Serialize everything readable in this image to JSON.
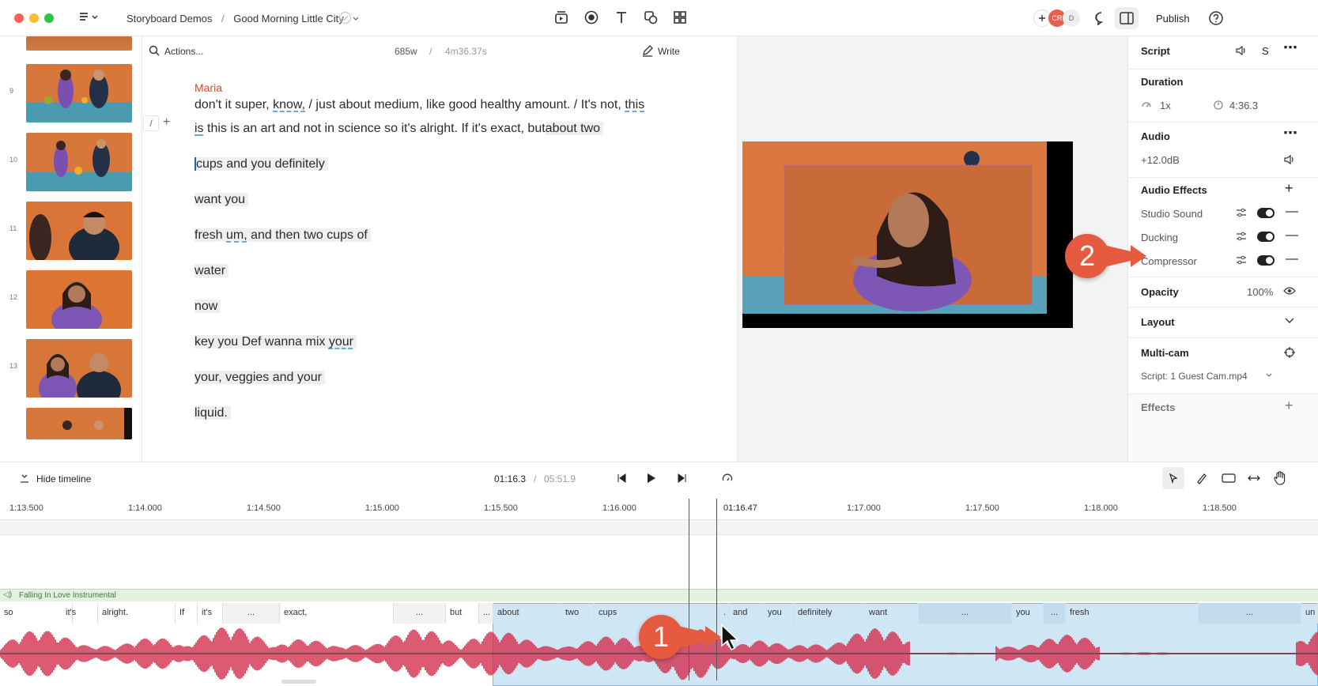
{
  "header": {
    "breadcrumb_project": "Storyboard Demos",
    "breadcrumb_separator": "/",
    "breadcrumb_doc": "Good Morning Little City",
    "avatar_initials_1": "CR",
    "avatar_initials_2": "D",
    "publish_label": "Publish"
  },
  "sidebar": {
    "scene_numbers": [
      "9",
      "10",
      "11",
      "12",
      "13"
    ]
  },
  "editor": {
    "search_label": "Actions...",
    "word_count": "685w",
    "divider": "/",
    "duration": "4m36.37s",
    "write_label": "Write",
    "speaker": "Maria",
    "line1_a": "don't it super, ",
    "line1_know": "know,",
    "line1_b": " / just about medium,   like good healthy amount. / It's not, ",
    "line1_this": "this",
    "line2_is": "is",
    "line2_b": " this is an art and not in science so it's alright. If it's exact, ",
    "line2_but": "but",
    "line2_chip": "about two",
    "line3": "cups and you definitely",
    "line4": "want you",
    "line5_a": "fresh ",
    "line5_um": "um,",
    "line5_b": " and then two cups of",
    "line6": "water",
    "line7": "now",
    "line8_a": "key you Def wanna mix ",
    "line8_your": "your",
    "line9": "your, veggies and your",
    "line10": "liquid."
  },
  "inspector": {
    "script_label": "Script",
    "script_s": "S",
    "duration_title": "Duration",
    "speed": "1x",
    "duration_value": "4:36.3",
    "audio_title": "Audio",
    "gain": "+12.0dB",
    "audio_effects_title": "Audio Effects",
    "effects": [
      {
        "name": "Studio Sound"
      },
      {
        "name": "Ducking"
      },
      {
        "name": "Compressor"
      }
    ],
    "opacity_title": "Opacity",
    "opacity_value": "100%",
    "layout_title": "Layout",
    "multicam_title": "Multi-cam",
    "multicam_value": "Script: 1 Guest Cam.mp4",
    "effects_title": "Effects"
  },
  "timeline": {
    "hide_label": "Hide timeline",
    "current_time": "01:16.3",
    "divider": "/",
    "total_time": "05:51.9",
    "playhead_label": "01:16.47",
    "ruler": [
      "1:13.500",
      "1:14.000",
      "1:14.500",
      "1:15.000",
      "1:15.500",
      "1:16.000",
      "1:17.000",
      "1:17.500",
      "1:18.000",
      "1:18.500"
    ],
    "music_track": "Falling In Love Instrumental",
    "words": [
      "so",
      "it's",
      "alright.",
      "If",
      "it's",
      "...",
      "exact,",
      "...",
      "but",
      "...",
      "about",
      "two",
      "cups",
      ".",
      "and",
      "you",
      "definitely",
      "want",
      "...",
      "you",
      "...",
      "fresh",
      "...",
      "un"
    ]
  },
  "callouts": [
    "1",
    "2"
  ],
  "colors": {
    "accent_red": "#e65a3f",
    "waveform": "#d4304f",
    "selection": "#cfe6f5",
    "music": "#e2f2df"
  }
}
